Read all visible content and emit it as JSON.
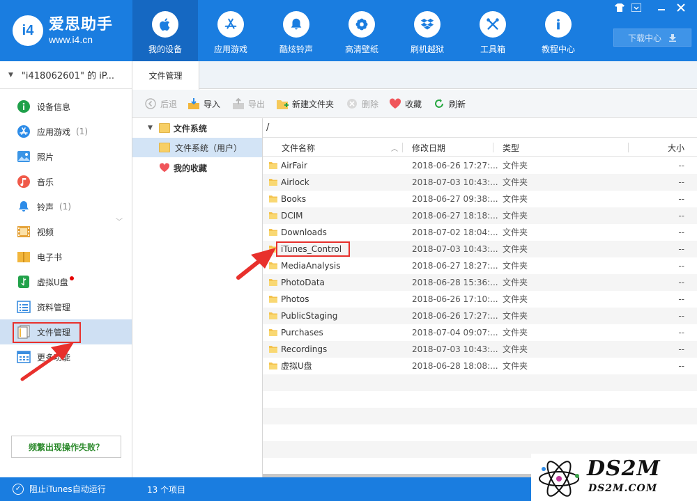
{
  "app": {
    "logo_title": "爱思助手",
    "logo_url": "www.i4.cn",
    "logo_mark": "i4"
  },
  "nav": [
    {
      "label": "我的设备",
      "icon": "apple-icon",
      "active": true
    },
    {
      "label": "应用游戏",
      "icon": "app-store-icon"
    },
    {
      "label": "酷炫铃声",
      "icon": "bell-icon"
    },
    {
      "label": "高清壁纸",
      "icon": "flower-icon"
    },
    {
      "label": "刷机越狱",
      "icon": "dropbox-icon"
    },
    {
      "label": "工具箱",
      "icon": "tools-icon"
    },
    {
      "label": "教程中心",
      "icon": "info-icon"
    }
  ],
  "window": {
    "downloads_label": "下载中心"
  },
  "device": {
    "name": "\"i418062601\" 的 iP..."
  },
  "sidebar": {
    "items": [
      {
        "label": "设备信息",
        "icon": "info-circle-icon"
      },
      {
        "label": "应用游戏",
        "count": "(1)",
        "icon": "app-store-icon"
      },
      {
        "label": "照片",
        "icon": "photo-icon"
      },
      {
        "label": "音乐",
        "icon": "music-icon"
      },
      {
        "label": "铃声",
        "count": "(1)",
        "icon": "bell-icon"
      },
      {
        "label": "视频",
        "icon": "film-icon"
      },
      {
        "label": "电子书",
        "icon": "book-icon"
      },
      {
        "label": "虚拟U盘",
        "icon": "usb-icon"
      },
      {
        "label": "资料管理",
        "icon": "contacts-icon"
      },
      {
        "label": "文件管理",
        "icon": "files-icon",
        "active": true
      },
      {
        "label": "更多功能",
        "icon": "grid-icon"
      }
    ],
    "help_label": "频繁出现操作失败？"
  },
  "tabs": [
    {
      "label": "文件管理"
    }
  ],
  "toolbar": {
    "back": "后退",
    "import": "导入",
    "export": "导出",
    "new_folder": "新建文件夹",
    "delete": "删除",
    "favorite": "收藏",
    "refresh": "刷新"
  },
  "tree": {
    "root": "文件系统",
    "child": "文件系统（用户）",
    "favorites": "我的收藏"
  },
  "path": "/",
  "list": {
    "columns": {
      "name": "文件名称",
      "date": "修改日期",
      "type": "类型",
      "size": "大小"
    },
    "rows": [
      {
        "name": "AirFair",
        "date": "2018-06-26 17:27:...",
        "type": "文件夹",
        "size": "--"
      },
      {
        "name": "Airlock",
        "date": "2018-07-03 10:43:...",
        "type": "文件夹",
        "size": "--"
      },
      {
        "name": "Books",
        "date": "2018-06-27 09:38:...",
        "type": "文件夹",
        "size": "--"
      },
      {
        "name": "DCIM",
        "date": "2018-06-27 18:18:...",
        "type": "文件夹",
        "size": "--"
      },
      {
        "name": "Downloads",
        "date": "2018-07-02 18:04:...",
        "type": "文件夹",
        "size": "--"
      },
      {
        "name": "iTunes_Control",
        "date": "2018-07-03 10:43:...",
        "type": "文件夹",
        "size": "--"
      },
      {
        "name": "MediaAnalysis",
        "date": "2018-06-27 18:27:...",
        "type": "文件夹",
        "size": "--"
      },
      {
        "name": "PhotoData",
        "date": "2018-06-28 15:36:...",
        "type": "文件夹",
        "size": "--"
      },
      {
        "name": "Photos",
        "date": "2018-06-26 17:10:...",
        "type": "文件夹",
        "size": "--"
      },
      {
        "name": "PublicStaging",
        "date": "2018-06-26 17:27:...",
        "type": "文件夹",
        "size": "--"
      },
      {
        "name": "Purchases",
        "date": "2018-07-04 09:07:...",
        "type": "文件夹",
        "size": "--"
      },
      {
        "name": "Recordings",
        "date": "2018-07-03 10:43:...",
        "type": "文件夹",
        "size": "--"
      },
      {
        "name": "虚拟U盘",
        "date": "2018-06-28 18:08:...",
        "type": "文件夹",
        "size": "--"
      }
    ]
  },
  "status": {
    "itunes_label": "阻止iTunes自动运行",
    "item_count": "13 个项目"
  },
  "watermark": {
    "big": "DS2M",
    "small": "DS2M.COM"
  },
  "colors": {
    "brand": "#1a7de0",
    "annotation": "#e8302c"
  }
}
